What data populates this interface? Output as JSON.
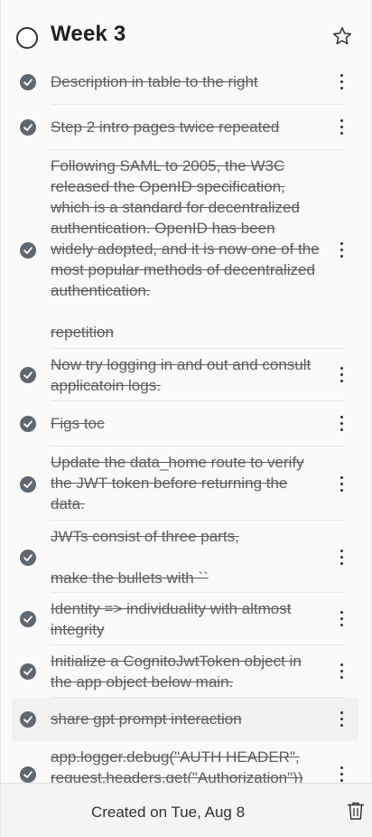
{
  "header": {
    "title": "Week 3"
  },
  "tasks": [
    {
      "text": "Description in table to the right"
    },
    {
      "text": "Step 2 intro pages twice repeated"
    },
    {
      "text": "Following SAML to 2005, the W3C released the OpenID specification, which is a standard for decentralized authentication. OpenID has been widely adopted, and it is now one of the most popular methods of decentralized authentication.\n\nrepetition"
    },
    {
      "text": "Now try logging in and out and consult applicatoin logs."
    },
    {
      "text": "Figs toc"
    },
    {
      "text": "Update the data_home route to verify the JWT token before returning the data."
    },
    {
      "text": "JWTs consist of three parts,\n\nmake the bullets with ``"
    },
    {
      "text": "Identity => individuality with altmost integrity"
    },
    {
      "text": "Initialize a CognitoJwtToken object in the app object below main."
    },
    {
      "text": "share gpt prompt interaction"
    },
    {
      "text": "app.logger.debug(\"AUTH HEADER\", request.headers.get(\"Authorization\"))"
    }
  ],
  "footer": {
    "created_label": "Created on Tue, Aug 8"
  }
}
